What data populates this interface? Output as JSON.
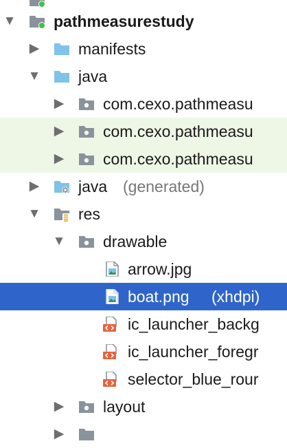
{
  "tree": {
    "rows": [
      {
        "label": "pathmeasurestudy",
        "secondary": "",
        "arrow": "▼",
        "icon": "module-folder-icon",
        "bold": true
      },
      {
        "label": "manifests",
        "secondary": "",
        "arrow": "▶",
        "icon": "folder-icon",
        "bold": false
      },
      {
        "label": "java",
        "secondary": "",
        "arrow": "▼",
        "icon": "folder-icon",
        "bold": false
      },
      {
        "label": "com.cexo.pathmeasu",
        "secondary": "",
        "arrow": "▶",
        "icon": "package-icon",
        "bold": false
      },
      {
        "label": "com.cexo.pathmeasu",
        "secondary": "",
        "arrow": "▶",
        "icon": "package-icon",
        "bold": false
      },
      {
        "label": "com.cexo.pathmeasu",
        "secondary": "",
        "arrow": "▶",
        "icon": "package-icon",
        "bold": false
      },
      {
        "label": "java",
        "secondary": "(generated)",
        "arrow": "▶",
        "icon": "generated-folder-icon",
        "bold": false
      },
      {
        "label": "res",
        "secondary": "",
        "arrow": "▼",
        "icon": "resources-folder-icon",
        "bold": false
      },
      {
        "label": "drawable",
        "secondary": "",
        "arrow": "▼",
        "icon": "package-icon",
        "bold": false
      },
      {
        "label": "arrow.jpg",
        "secondary": "",
        "arrow": "",
        "icon": "image-file-icon",
        "bold": false
      },
      {
        "label": "boat.png",
        "secondary": "(xhdpi)",
        "arrow": "",
        "icon": "image-file-icon",
        "bold": false
      },
      {
        "label": "ic_launcher_backg",
        "secondary": "",
        "arrow": "",
        "icon": "xml-file-icon",
        "bold": false
      },
      {
        "label": "ic_launcher_foregr",
        "secondary": "",
        "arrow": "",
        "icon": "xml-file-icon",
        "bold": false
      },
      {
        "label": "selector_blue_rour",
        "secondary": "",
        "arrow": "",
        "icon": "xml-file-icon",
        "bold": false
      },
      {
        "label": "layout",
        "secondary": "",
        "arrow": "▶",
        "icon": "package-icon",
        "bold": false
      }
    ]
  },
  "colors": {
    "selection": "#2f65ca",
    "highlight_green": "#eef7e6",
    "folder_blue": "#7fc3e8",
    "folder_gray": "#8a939c",
    "module_dot": "#3cc24e",
    "xml_badge": "#e8623b"
  }
}
